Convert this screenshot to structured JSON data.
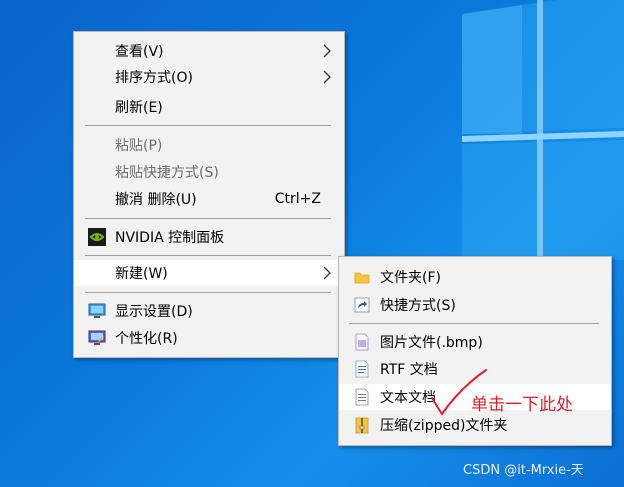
{
  "context_menu": {
    "items": [
      {
        "label": "查看(V)"
      },
      {
        "label": "排序方式(O)"
      },
      {
        "label": "刷新(E)"
      },
      {
        "label": "粘贴(P)"
      },
      {
        "label": "粘贴快捷方式(S)"
      },
      {
        "label": "撤消 删除(U)",
        "shortcut": "Ctrl+Z"
      },
      {
        "label": "NVIDIA 控制面板"
      },
      {
        "label": "新建(W)"
      },
      {
        "label": "显示设置(D)"
      },
      {
        "label": "个性化(R)"
      }
    ]
  },
  "submenu": {
    "items": [
      {
        "label": "文件夹(F)"
      },
      {
        "label": "快捷方式(S)"
      },
      {
        "label": "图片文件(.bmp)"
      },
      {
        "label": "RTF 文档"
      },
      {
        "label": "文本文档"
      },
      {
        "label": "压缩(zipped)文件夹"
      }
    ]
  },
  "annotation": {
    "text": "单击一下此处"
  },
  "watermark": "CSDN @it-Mrxie-天",
  "colors": {
    "desktop": "#0b79dc",
    "menu_bg": "#f2f2f2",
    "hover": "#ffffff",
    "annotation": "#e0202a"
  }
}
